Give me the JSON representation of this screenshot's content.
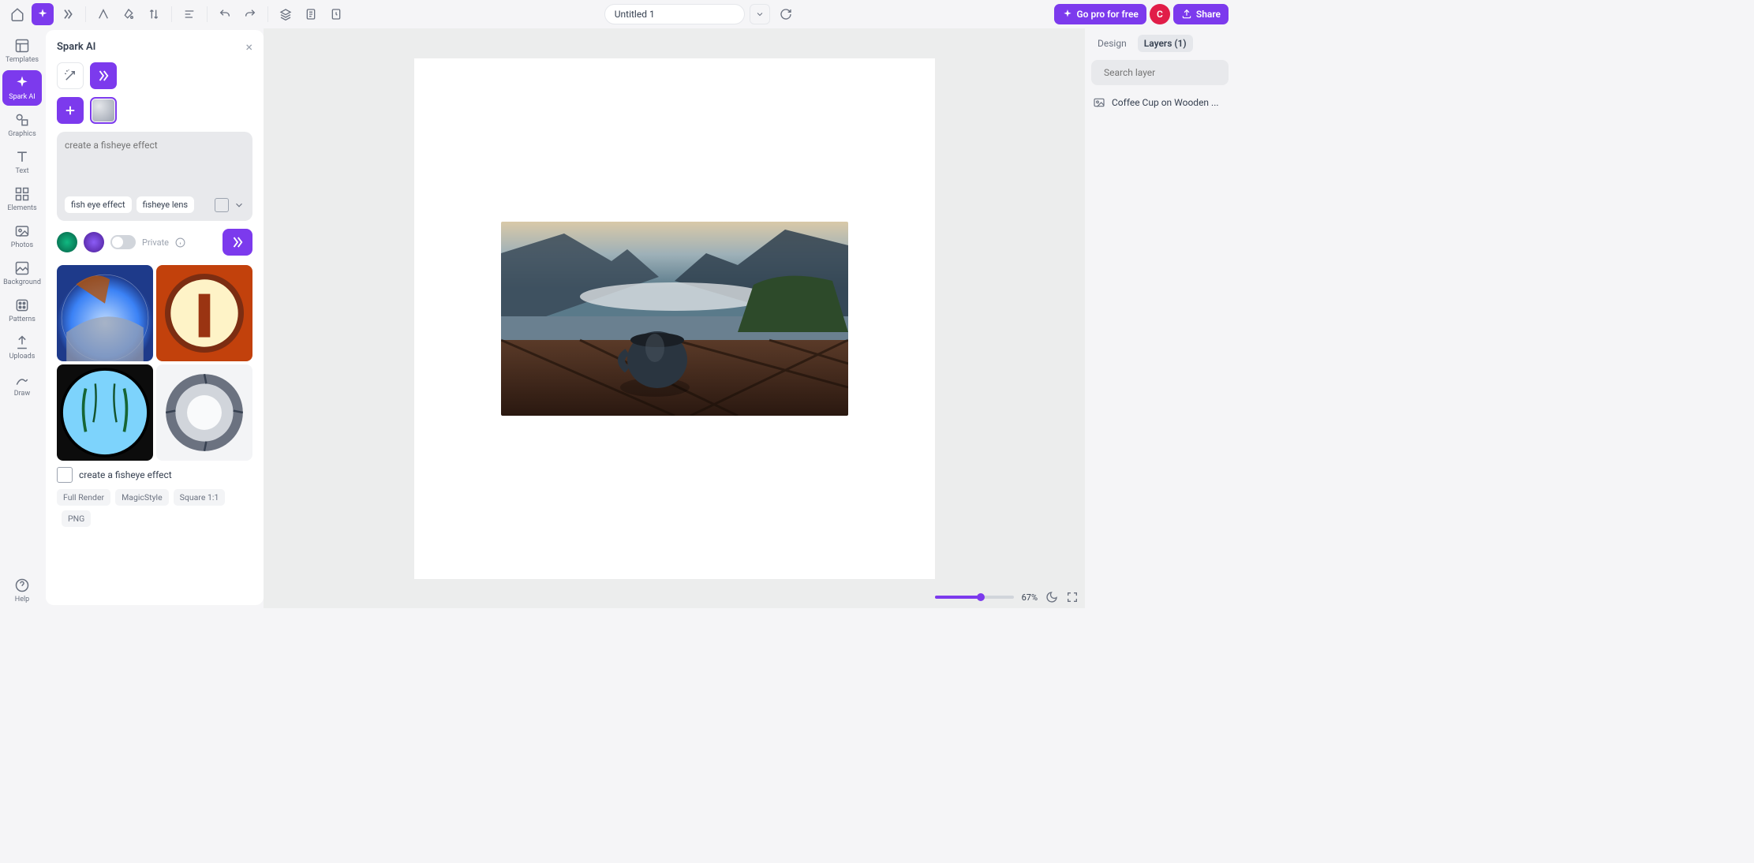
{
  "topbar": {
    "title": "Untitled 1",
    "go_pro": "Go pro for free",
    "share": "Share",
    "avatar_initial": "C"
  },
  "left_nav": {
    "items": [
      {
        "label": "Templates"
      },
      {
        "label": "Spark AI"
      },
      {
        "label": "Graphics"
      },
      {
        "label": "Text"
      },
      {
        "label": "Elements"
      },
      {
        "label": "Photos"
      },
      {
        "label": "Background"
      },
      {
        "label": "Patterns"
      },
      {
        "label": "Uploads"
      },
      {
        "label": "Draw"
      }
    ],
    "help": "Help"
  },
  "spark": {
    "title": "Spark AI",
    "prompt_placeholder": "create a fisheye effect",
    "chips": [
      "fish eye effect",
      "fisheye lens"
    ],
    "private_label": "Private",
    "caption": "create a fisheye effect",
    "tags": [
      "Full Render",
      "MagicStyle",
      "Square 1:1",
      "PNG"
    ]
  },
  "right": {
    "tabs": {
      "design": "Design",
      "layers": "Layers (1)"
    },
    "search_placeholder": "Search layer",
    "layer_name": "Coffee Cup on Wooden ..."
  },
  "bottom": {
    "zoom": "67%"
  }
}
